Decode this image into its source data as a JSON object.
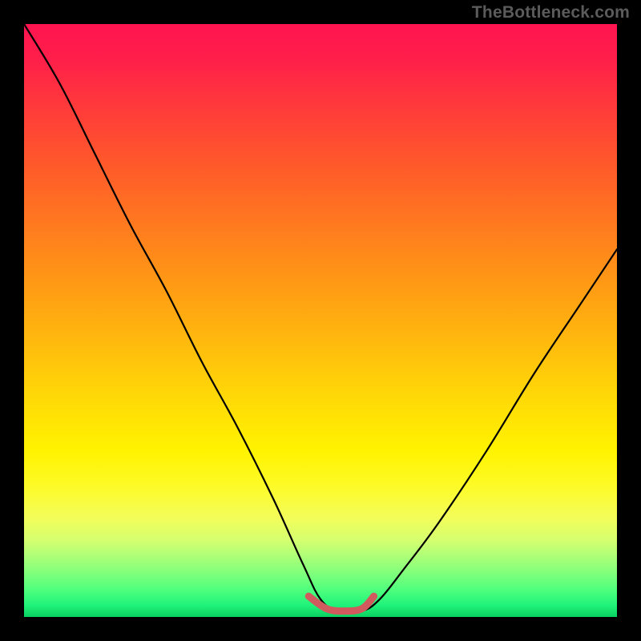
{
  "watermark": "TheBottleneck.com",
  "colors": {
    "curve_stroke": "#000000",
    "bump_stroke": "#d05a5d",
    "gradient_top": "#ff1450",
    "gradient_mid": "#fff300",
    "gradient_bottom": "#0ad062",
    "page_bg": "#000000"
  },
  "chart_data": {
    "type": "line",
    "title": "",
    "xlabel": "",
    "ylabel": "",
    "xlim": [
      0,
      100
    ],
    "ylim": [
      0,
      100
    ],
    "grid": false,
    "series": [
      {
        "name": "bottleneck-curve",
        "x": [
          0,
          6,
          12,
          18,
          24,
          30,
          36,
          42,
          47,
          50,
          53,
          57,
          60,
          64,
          70,
          78,
          86,
          94,
          100
        ],
        "y": [
          100,
          90,
          78,
          66,
          55,
          43,
          32,
          20,
          9,
          3,
          1,
          1,
          3,
          8,
          16,
          28,
          41,
          53,
          62
        ],
        "stroke": "#000000"
      },
      {
        "name": "valley-highlight",
        "x": [
          48,
          51,
          54,
          57,
          59
        ],
        "y": [
          3.5,
          1.4,
          1.0,
          1.4,
          3.5
        ],
        "stroke": "#d05a5d"
      }
    ],
    "background_gradient": {
      "direction": "vertical",
      "stops": [
        {
          "pos": 0.0,
          "color": "#ff1450"
        },
        {
          "pos": 0.35,
          "color": "#ff8a17"
        },
        {
          "pos": 0.72,
          "color": "#fff300"
        },
        {
          "pos": 0.9,
          "color": "#a9ff78"
        },
        {
          "pos": 1.0,
          "color": "#0ad062"
        }
      ]
    }
  }
}
